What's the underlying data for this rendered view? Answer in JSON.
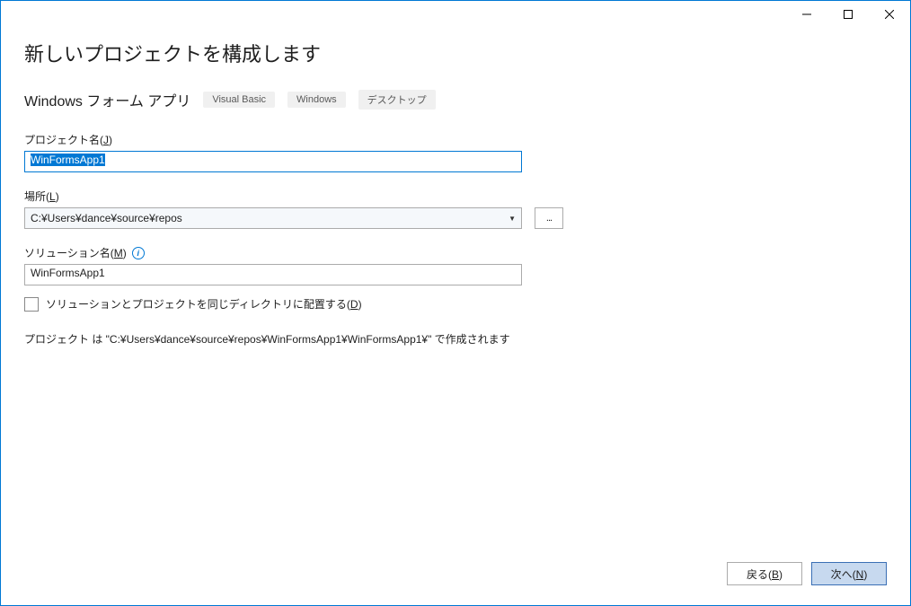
{
  "heading": "新しいプロジェクトを構成します",
  "templateName": "Windows フォーム アプリ",
  "tags": [
    "Visual Basic",
    "Windows",
    "デスクトップ"
  ],
  "projectName": {
    "labelPrefix": "プロジェクト名(",
    "labelKey": "J",
    "labelSuffix": ")",
    "value": "WinFormsApp1"
  },
  "location": {
    "labelPrefix": "場所(",
    "labelKey": "L",
    "labelSuffix": ")",
    "value": "C:¥Users¥dance¥source¥repos"
  },
  "browseLabel": "...",
  "solutionName": {
    "labelPrefix": "ソリューション名(",
    "labelKey": "M",
    "labelSuffix": ")",
    "value": "WinFormsApp1"
  },
  "sameDir": {
    "labelPrefix": "ソリューションとプロジェクトを同じディレクトリに配置する(",
    "labelKey": "D",
    "labelSuffix": ")",
    "checked": false
  },
  "pathPreview": "プロジェクト は \"C:¥Users¥dance¥source¥repos¥WinFormsApp1¥WinFormsApp1¥\" で作成されます",
  "buttons": {
    "back": {
      "prefix": "戻る(",
      "key": "B",
      "suffix": ")"
    },
    "next": {
      "prefix": "次へ(",
      "key": "N",
      "suffix": ")"
    }
  }
}
